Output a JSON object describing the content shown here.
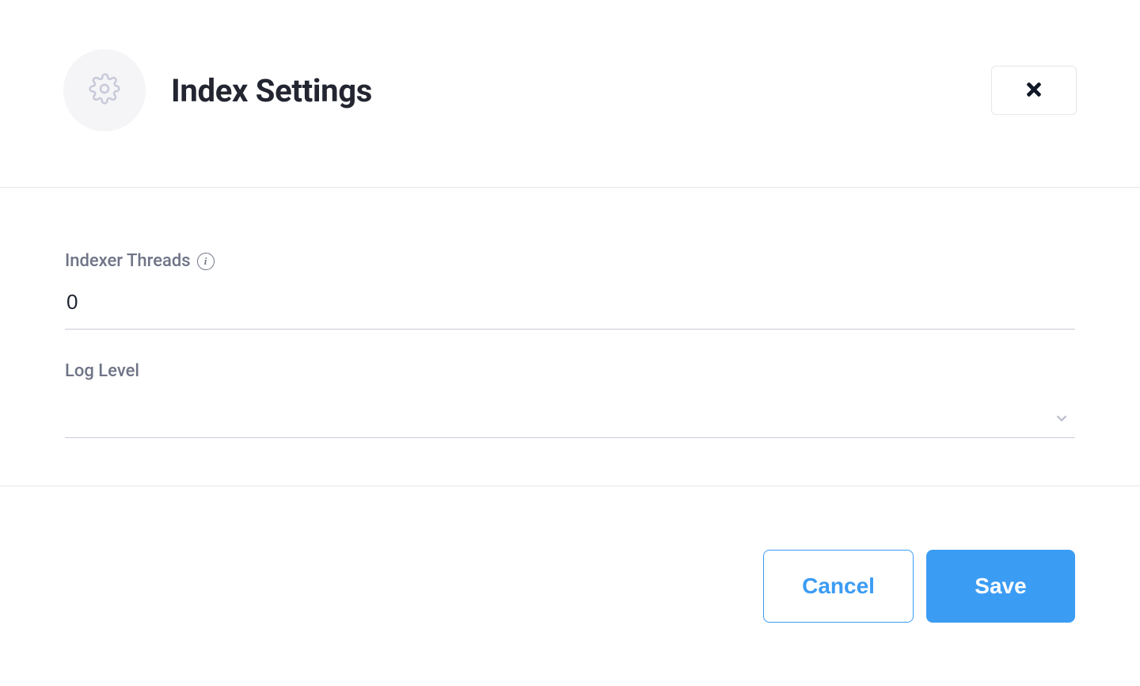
{
  "header": {
    "title": "Index Settings"
  },
  "form": {
    "indexer_threads": {
      "label": "Indexer Threads",
      "value": "0"
    },
    "log_level": {
      "label": "Log Level",
      "value": ""
    }
  },
  "footer": {
    "cancel_label": "Cancel",
    "save_label": "Save"
  }
}
